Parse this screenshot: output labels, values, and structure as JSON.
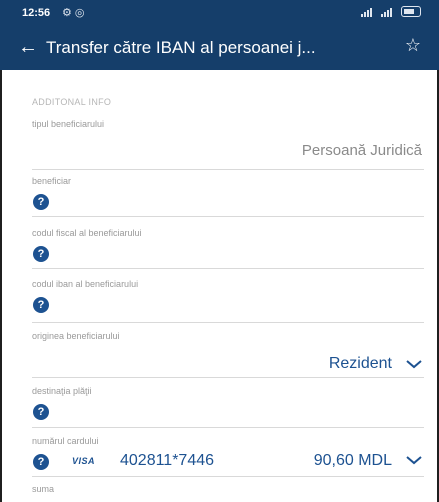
{
  "status_bar": {
    "time": "12:56",
    "left_icons": "⚙ ◎"
  },
  "header": {
    "title": "Transfer către IBAN al persoanei j...",
    "back_icon": "arrow-left",
    "favorite_icon": "star-outline"
  },
  "section": {
    "title": "ADDITONAL INFO"
  },
  "fields": {
    "beneficiary_type": {
      "label": "tipul beneficiarului",
      "value": "Persoană Juridică"
    },
    "beneficiary": {
      "label": "beneficiar"
    },
    "fiscal_code": {
      "label": "codul fiscal al beneficiarului"
    },
    "iban_code": {
      "label": "codul iban al beneficiarului"
    },
    "beneficiary_origin": {
      "label": "originea beneficiarului",
      "value": "Rezident"
    },
    "payment_destination": {
      "label": "destinaţia plăţii"
    },
    "card_number": {
      "label": "numărul cardului",
      "card_brand": "VISA",
      "number": "402811*7446",
      "balance": "90,60 MDL"
    },
    "amount": {
      "label": "suma"
    }
  },
  "help_icon_glyph": "?",
  "colors": {
    "header_bg": "#153e6a",
    "accent": "#1d5291",
    "label": "#9a9a9a",
    "divider": "#d9d9d9"
  }
}
